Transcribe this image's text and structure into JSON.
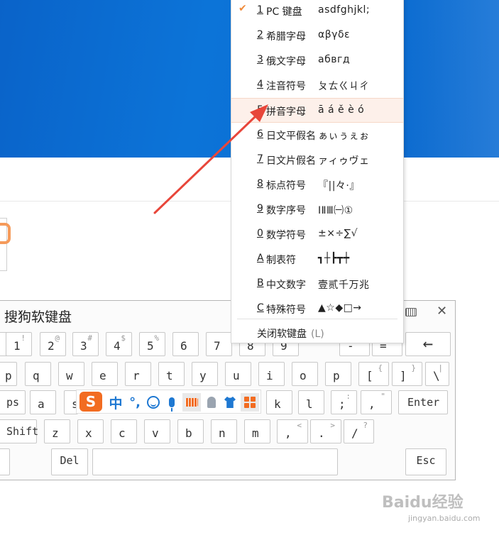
{
  "keyboard": {
    "title": "搜狗软键盘",
    "close_icon": "✕",
    "rows": [
      [
        {
          "lo": "",
          "up": ""
        },
        {
          "lo": "1",
          "up": "!"
        },
        {
          "lo": "2",
          "up": "@"
        },
        {
          "lo": "3",
          "up": "#"
        },
        {
          "lo": "4",
          "up": "$"
        },
        {
          "lo": "5",
          "up": "%"
        },
        {
          "lo": "6",
          "up": ""
        },
        {
          "lo": "7",
          "up": ""
        },
        {
          "lo": "8",
          "up": ""
        },
        {
          "lo": "9",
          "up": ""
        },
        {
          "lo": "-",
          "up": ""
        },
        {
          "lo": "=",
          "up": ""
        },
        {
          "lo": "←",
          "up": ""
        }
      ],
      [
        {
          "lo": "p",
          "up": ""
        },
        {
          "lo": "q",
          "up": ""
        },
        {
          "lo": "w",
          "up": ""
        },
        {
          "lo": "e",
          "up": ""
        },
        {
          "lo": "r",
          "up": ""
        },
        {
          "lo": "t",
          "up": ""
        },
        {
          "lo": "y",
          "up": ""
        },
        {
          "lo": "u",
          "up": ""
        },
        {
          "lo": "i",
          "up": ""
        },
        {
          "lo": "o",
          "up": ""
        },
        {
          "lo": "p",
          "up": ""
        },
        {
          "lo": "[",
          "up": "{"
        },
        {
          "lo": "]",
          "up": "}"
        },
        {
          "lo": "\\",
          "up": "|"
        }
      ],
      [
        {
          "lo": "ps",
          "up": ""
        },
        {
          "lo": "a",
          "up": ""
        },
        {
          "lo": "s",
          "up": ""
        },
        {
          "lo": "k",
          "up": ""
        },
        {
          "lo": "l",
          "up": ""
        },
        {
          "lo": ";",
          "up": ":"
        },
        {
          "lo": ",",
          "up": "\""
        },
        {
          "lo": "Enter",
          "up": ""
        }
      ],
      [
        {
          "lo": "Shift",
          "up": ""
        },
        {
          "lo": "z",
          "up": ""
        },
        {
          "lo": "x",
          "up": ""
        },
        {
          "lo": "c",
          "up": ""
        },
        {
          "lo": "v",
          "up": ""
        },
        {
          "lo": "b",
          "up": ""
        },
        {
          "lo": "n",
          "up": ""
        },
        {
          "lo": "m",
          "up": ""
        },
        {
          "lo": ",",
          "up": "<"
        },
        {
          "lo": ".",
          "up": ">"
        },
        {
          "lo": "/",
          "up": "?"
        }
      ],
      [
        {
          "lo": "",
          "up": ""
        },
        {
          "lo": "Del",
          "up": ""
        },
        {
          "lo": "",
          "up": ""
        },
        {
          "lo": "Esc",
          "up": ""
        }
      ]
    ]
  },
  "sogou_toolbar": {
    "logo": "S",
    "mode": "中",
    "punct": "°,",
    "icons": [
      "emoji-icon",
      "microphone-icon",
      "keyboard-icon",
      "user-icon",
      "skin-icon",
      "toolbox-icon"
    ]
  },
  "menu": {
    "items": [
      {
        "num": "1",
        "label": "PC 键盘",
        "sample": "asdfghjkl;",
        "checked": true,
        "selected": false
      },
      {
        "num": "2",
        "label": "希腊字母",
        "sample": "αβγδε",
        "checked": false,
        "selected": false
      },
      {
        "num": "3",
        "label": "俄文字母",
        "sample": "абвгд",
        "checked": false,
        "selected": false
      },
      {
        "num": "4",
        "label": "注音符号",
        "sample": "ㄆㄊㄍㄐㄔ",
        "checked": false,
        "selected": false
      },
      {
        "num": "5",
        "label": "拼音字母",
        "sample": "ā á ě è ó",
        "checked": false,
        "selected": true
      },
      {
        "num": "6",
        "label": "日文平假名",
        "sample": "ぁぃぅぇぉ",
        "checked": false,
        "selected": false
      },
      {
        "num": "7",
        "label": "日文片假名",
        "sample": "ァィゥヴェ",
        "checked": false,
        "selected": false
      },
      {
        "num": "8",
        "label": "标点符号",
        "sample": "『||々·』",
        "checked": false,
        "selected": false
      },
      {
        "num": "9",
        "label": "数字序号",
        "sample": "ⅠⅡⅢ㈠①",
        "checked": false,
        "selected": false
      },
      {
        "num": "0",
        "label": "数学符号",
        "sample": "±×÷∑√",
        "checked": false,
        "selected": false
      },
      {
        "num": "A",
        "label": "制表符",
        "sample": "┓┼┣┳┿",
        "checked": false,
        "selected": false
      },
      {
        "num": "B",
        "label": "中文数字",
        "sample": "壹贰千万兆",
        "checked": false,
        "selected": false
      },
      {
        "num": "C",
        "label": "特殊符号",
        "sample": "▲☆◆□→",
        "checked": false,
        "selected": false
      }
    ],
    "close_label": "关闭软键盘",
    "close_shortcut": "(L)",
    "check_icon": "✔"
  },
  "watermark": {
    "text": "Baidu经验",
    "url": "jingyan.baidu.com"
  }
}
